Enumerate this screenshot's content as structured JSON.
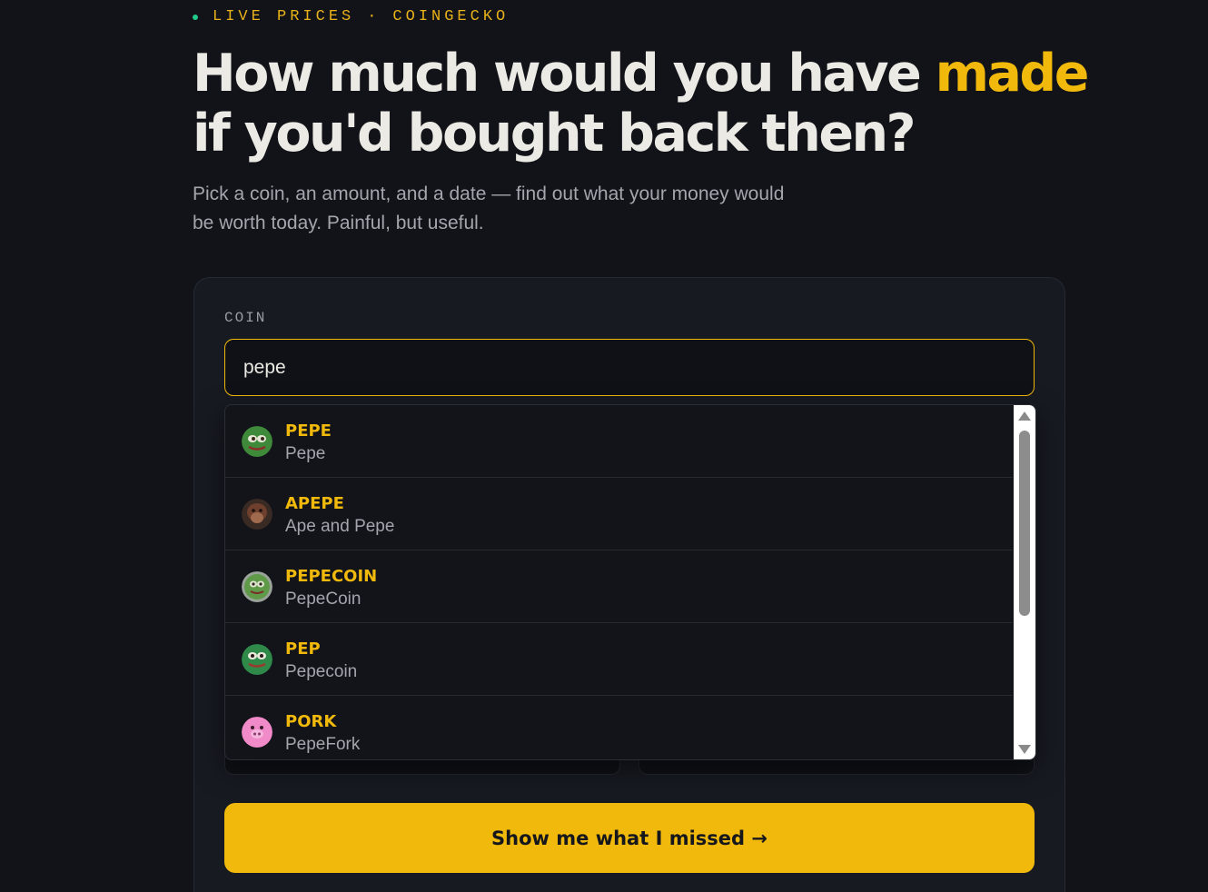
{
  "header": {
    "eyebrow_left": "LIVE PRICES",
    "eyebrow_separator": "·",
    "eyebrow_right": "COINGECKO",
    "status_dot_color": "#22c98a",
    "headline_part1": "How much would you have ",
    "headline_accent": "made",
    "headline_part2": "if you'd bought back then?",
    "subtitle": "Pick a coin, an amount, and a date — find out what your money would be worth today. Painful, but useful."
  },
  "form": {
    "coin_label": "COIN",
    "coin_value": "pepe",
    "submit_label": "Show me what I missed →"
  },
  "dropdown": {
    "items": [
      {
        "symbol": "PEPE",
        "name": "Pepe",
        "icon": "pepe-frog-icon"
      },
      {
        "symbol": "APEPE",
        "name": "Ape and Pepe",
        "icon": "ape-icon"
      },
      {
        "symbol": "PEPECOIN",
        "name": "PepeCoin",
        "icon": "pepecoin-icon"
      },
      {
        "symbol": "PEP",
        "name": "Pepecoin",
        "icon": "pep-frog-icon"
      },
      {
        "symbol": "PORK",
        "name": "PepeFork",
        "icon": "pork-pig-icon"
      }
    ]
  },
  "colors": {
    "background": "#111318",
    "accent": "#f0b90b",
    "card": "#171a21"
  }
}
